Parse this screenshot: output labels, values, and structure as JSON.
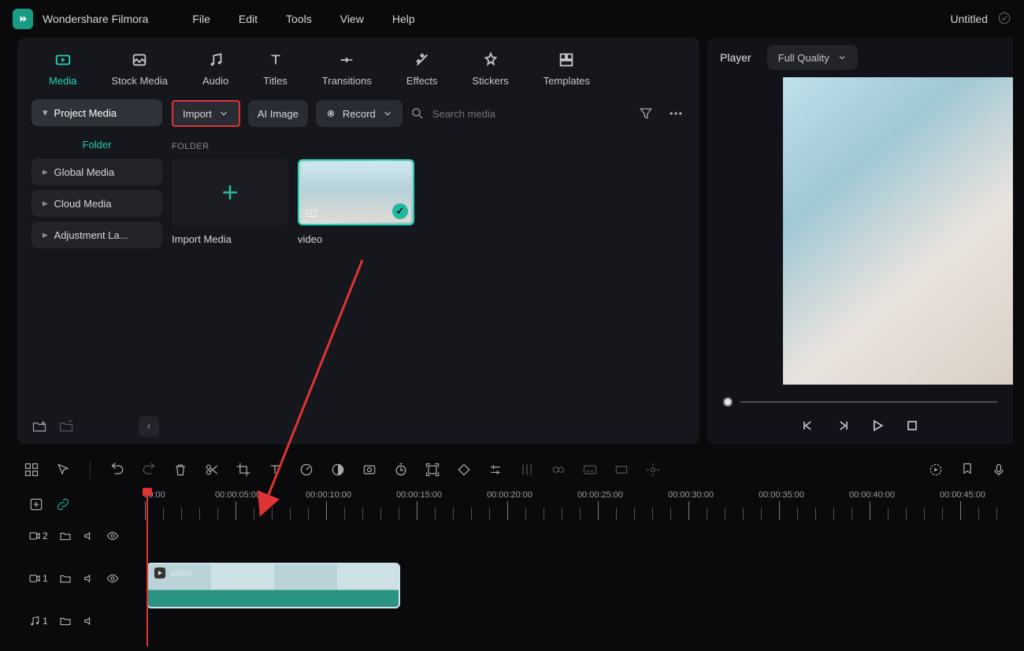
{
  "titlebar": {
    "app_name": "Wondershare Filmora",
    "menus": [
      "File",
      "Edit",
      "Tools",
      "View",
      "Help"
    ],
    "project_title": "Untitled"
  },
  "tabs": [
    {
      "id": "media",
      "label": "Media",
      "active": true
    },
    {
      "id": "stock-media",
      "label": "Stock Media"
    },
    {
      "id": "audio",
      "label": "Audio"
    },
    {
      "id": "titles",
      "label": "Titles"
    },
    {
      "id": "transitions",
      "label": "Transitions"
    },
    {
      "id": "effects",
      "label": "Effects"
    },
    {
      "id": "stickers",
      "label": "Stickers"
    },
    {
      "id": "templates",
      "label": "Templates"
    }
  ],
  "sidebar": {
    "project_media": "Project Media",
    "folder_label": "Folder",
    "items": [
      {
        "label": "Global Media"
      },
      {
        "label": "Cloud Media"
      },
      {
        "label": "Adjustment La..."
      }
    ]
  },
  "toolbar": {
    "import": "Import",
    "ai_image": "AI Image",
    "record": "Record",
    "search_placeholder": "Search media"
  },
  "media": {
    "section": "FOLDER",
    "import_label": "Import Media",
    "video_label": "video"
  },
  "player": {
    "title": "Player",
    "quality": "Full Quality"
  },
  "timeline": {
    "ticks": [
      "00:00",
      "00:00:05:00",
      "00:00:10:00",
      "00:00:15:00",
      "00:00:20:00",
      "00:00:25:00",
      "00:00:30:00",
      "00:00:35:00",
      "00:00:40:00",
      "00:00:45:00"
    ],
    "clip_label": "video",
    "lanes": {
      "video2": "2",
      "video1": "1",
      "audio1": "1"
    }
  }
}
